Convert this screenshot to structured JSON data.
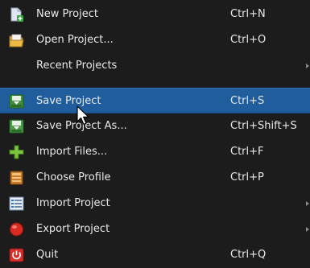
{
  "menu": {
    "items": [
      {
        "label": "New Project",
        "shortcut": "Ctrl+N",
        "icon": "new-project-icon"
      },
      {
        "label": "Open Project...",
        "shortcut": "Ctrl+O",
        "icon": "folder-open-icon"
      },
      {
        "label": "Recent Projects",
        "shortcut": "",
        "icon": "",
        "submenu": true
      },
      {
        "label": "Save Project",
        "shortcut": "Ctrl+S",
        "icon": "save-icon",
        "selected": true
      },
      {
        "label": "Save Project As...",
        "shortcut": "Ctrl+Shift+S",
        "icon": "save-as-icon"
      },
      {
        "label": "Import Files...",
        "shortcut": "Ctrl+F",
        "icon": "plus-icon"
      },
      {
        "label": "Choose Profile",
        "shortcut": "Ctrl+P",
        "icon": "profile-icon"
      },
      {
        "label": "Import Project",
        "shortcut": "",
        "icon": "list-icon",
        "submenu": true
      },
      {
        "label": "Export Project",
        "shortcut": "",
        "icon": "red-circle-icon",
        "submenu": true
      },
      {
        "label": "Quit",
        "shortcut": "Ctrl+Q",
        "icon": "power-icon"
      }
    ]
  },
  "colors": {
    "background": "#1c1c1c",
    "selection": "#1f5d9c",
    "text": "#e8e8e8"
  }
}
